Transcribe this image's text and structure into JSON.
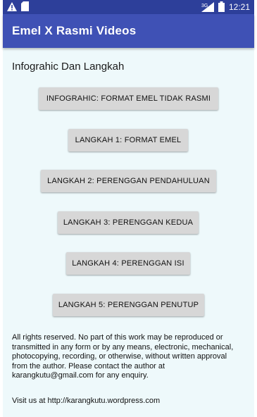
{
  "status_bar": {
    "time": "12:21",
    "network_label": "3G",
    "icons": [
      "warning-icon",
      "sd-card-icon",
      "signal-icon",
      "battery-icon"
    ]
  },
  "app_bar": {
    "title": "Emel X Rasmi Videos",
    "color": "#3f51b5",
    "status_color": "#2d3f9a"
  },
  "content": {
    "heading": "Infograhic Dan Langkah",
    "buttons": [
      "INFOGRAHIC: FORMAT EMEL TIDAK RASMI",
      "LANGKAH 1: FORMAT EMEL",
      "LANGKAH 2: PERENGGAN PENDAHULUAN",
      "LANGKAH 3: PERENGGAN KEDUA",
      "LANGKAH 4: PERENGGAN ISI",
      "LANGKAH 5: PERENGGAN PENUTUP"
    ],
    "legal_text": "All rights reserved. No part of this work may be reproduced or transmitted in any form or by any means, electronic, mechanical, photocopying, recording, or otherwise, without written approval from the author. Please contact the author at karangkutu@gmail.com for any enquiry.",
    "visit_text": "Visit us at http://karangkutu.wordpress.com"
  }
}
